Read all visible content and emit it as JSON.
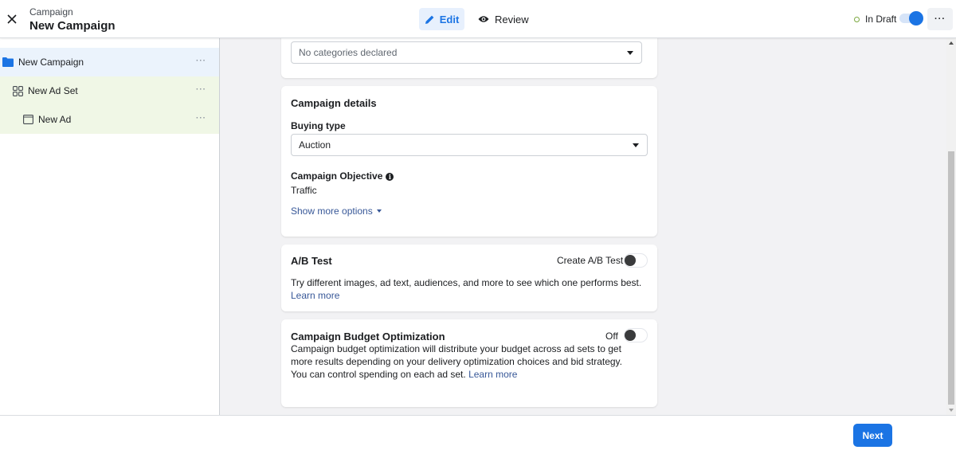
{
  "header": {
    "breadcrumb_label": "Campaign",
    "title": "New Campaign",
    "close_icon": "close-icon",
    "modes": [
      {
        "label": "Edit",
        "icon": "pencil-icon",
        "active": true
      },
      {
        "label": "Review",
        "icon": "eye-icon",
        "active": false
      }
    ],
    "status": "In Draft",
    "status_color": "#7ca840",
    "toggle_on": true,
    "more_label": "···",
    "accent": "#1b74e4"
  },
  "sidebar": {
    "items": [
      {
        "label": "New Campaign",
        "icon": "folder-icon",
        "more": "···",
        "level": "campaign"
      },
      {
        "label": "New Ad Set",
        "icon": "grid-icon",
        "more": "···",
        "level": "adset"
      },
      {
        "label": "New Ad",
        "icon": "ad-frame-icon",
        "more": "···",
        "level": "ad"
      }
    ]
  },
  "content": {
    "categories_select": {
      "value": "No categories declared"
    },
    "campaign_details": {
      "title": "Campaign details",
      "buying_type_label": "Buying type",
      "buying_type_value": "Auction",
      "objective_label": "Campaign Objective",
      "objective_value": "Traffic",
      "show_more": "Show more options"
    },
    "ab_test": {
      "title": "A/B Test",
      "toggle_label": "Create A/B Test",
      "toggle_on": false,
      "description": "Try different images, ad text, audiences, and more to see which one performs best.",
      "learn_more_1": "Learn",
      "learn_more_2": "more"
    },
    "budget_optimization": {
      "title": "Campaign Budget Optimization",
      "toggle_label": "Off",
      "toggle_on": false,
      "description_1": "Campaign budget optimization will distribute your budget across ad sets to get",
      "description_2": "more results depending on your delivery optimization choices and bid strategy.",
      "description_3": "You can control spending on each ad set.",
      "learn_more": "Learn more"
    }
  },
  "footer": {
    "next_label": "Next"
  }
}
